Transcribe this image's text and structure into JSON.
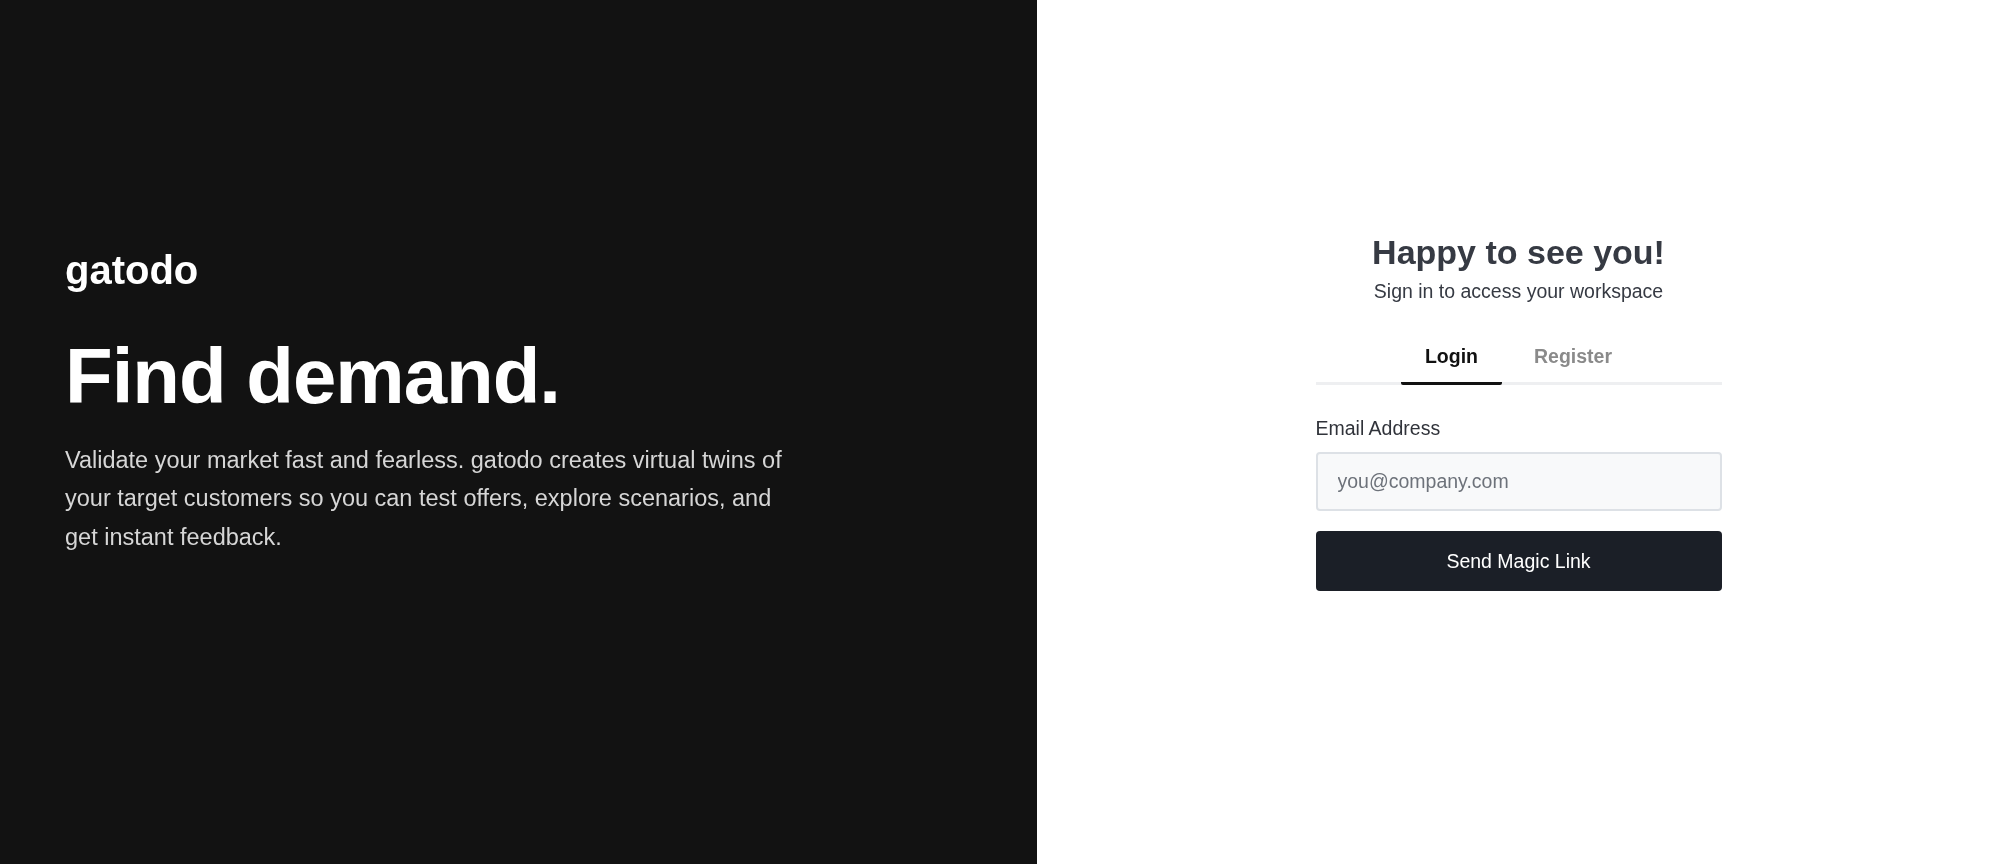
{
  "brand": {
    "logo": "gatodo",
    "headline": "Find demand.",
    "description": "Validate your market fast and fearless. gatodo creates virtual twins of your target customers so you can test offers, explore scenarios, and get instant feedback."
  },
  "form": {
    "title": "Happy to see you!",
    "subtitle": "Sign in to access your workspace",
    "tabs": [
      {
        "label": "Login",
        "selected": true
      },
      {
        "label": "Register",
        "selected": false
      }
    ],
    "email": {
      "label": "Email Address",
      "placeholder": "you@company.com"
    },
    "submit": "Send Magic Link"
  }
}
